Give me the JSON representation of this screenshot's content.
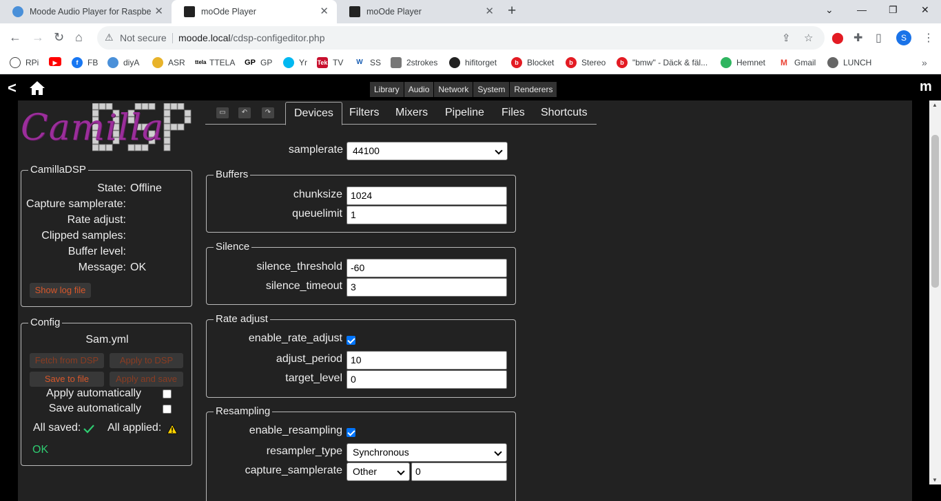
{
  "browser": {
    "tabs": [
      {
        "title": "Moode Audio Player for Raspberr",
        "active": false
      },
      {
        "title": "moOde Player",
        "active": true
      },
      {
        "title": "moOde Player",
        "active": false
      }
    ],
    "address": {
      "security": "Not secure",
      "host": "moode.local",
      "path": "/cdsp-configeditor.php"
    },
    "profile_initial": "S",
    "bookmarks": [
      "RPi",
      "",
      "FB",
      "diyA",
      "ASR",
      "TTELA",
      "GP",
      "Yr",
      "TV",
      "SS",
      "2strokes",
      "hifitorget",
      "Blocket",
      "Stereo",
      "\"bmw\" - Däck & fäl...",
      "Hemnet",
      "Gmail",
      "LUNCH"
    ]
  },
  "app": {
    "menu": [
      "Library",
      "Audio",
      "Network",
      "System",
      "Renderers"
    ],
    "brand": "m"
  },
  "logo": {
    "script": "Camilla",
    "block": "DSP"
  },
  "status": {
    "legend": "CamillaDSP",
    "state_label": "State:",
    "state_value": "Offline",
    "capture_samplerate_label": "Capture samplerate:",
    "rate_adjust_label": "Rate adjust:",
    "clipped_samples_label": "Clipped samples:",
    "buffer_level_label": "Buffer level:",
    "message_label": "Message:",
    "message_value": "OK",
    "show_log_button": "Show log file"
  },
  "config": {
    "legend": "Config",
    "filename": "Sam.yml",
    "fetch_button": "Fetch from DSP",
    "apply_button": "Apply to DSP",
    "save_button": "Save to file",
    "apply_save_button": "Apply and save",
    "apply_auto_label": "Apply automatically",
    "save_auto_label": "Save automatically",
    "all_saved_label": "All saved:",
    "all_applied_label": "All applied:",
    "status": "OK"
  },
  "editor_tabs": [
    "Devices",
    "Filters",
    "Mixers",
    "Pipeline",
    "Files",
    "Shortcuts"
  ],
  "devices": {
    "samplerate_label": "samplerate",
    "samplerate_value": "44100",
    "buffers": {
      "legend": "Buffers",
      "chunksize_label": "chunksize",
      "chunksize_value": "1024",
      "queuelimit_label": "queuelimit",
      "queuelimit_value": "1"
    },
    "silence": {
      "legend": "Silence",
      "threshold_label": "silence_threshold",
      "threshold_value": "-60",
      "timeout_label": "silence_timeout",
      "timeout_value": "3"
    },
    "rate_adjust": {
      "legend": "Rate adjust",
      "enable_label": "enable_rate_adjust",
      "period_label": "adjust_period",
      "period_value": "10",
      "target_label": "target_level",
      "target_value": "0"
    },
    "resampling": {
      "legend": "Resampling",
      "enable_label": "enable_resampling",
      "type_label": "resampler_type",
      "type_value": "Synchronous",
      "capture_label": "capture_samplerate",
      "capture_select": "Other",
      "capture_value": "0"
    }
  },
  "colors": {
    "accent_button_text": "#d9572a",
    "ok_green": "#2ecc71",
    "panel_bg": "#222222"
  }
}
